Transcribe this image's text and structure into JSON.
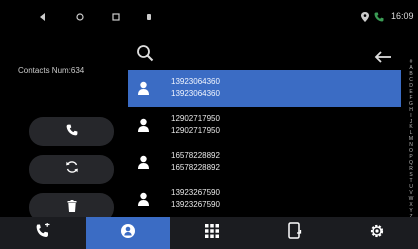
{
  "status_bar": {
    "time": "16:09",
    "icons": [
      "back-triangle-icon",
      "home-circle-icon",
      "recent-square-icon",
      "app-notification-icon",
      "location-icon",
      "phone-icon"
    ]
  },
  "left_panel": {
    "contacts_label": "Contacts Num:634",
    "buttons": [
      {
        "name": "call-button",
        "icon": "phone-icon"
      },
      {
        "name": "sync-button",
        "icon": "refresh-icon"
      },
      {
        "name": "delete-button",
        "icon": "trash-icon"
      }
    ]
  },
  "top_bar": {
    "search_icon": "search-icon",
    "back_icon": "arrow-left-icon"
  },
  "contacts": [
    {
      "line1": "13923064360",
      "line2": "13923064360",
      "selected": true
    },
    {
      "line1": "12902717950",
      "line2": "12902717950",
      "selected": false
    },
    {
      "line1": "16578228892",
      "line2": "16578228892",
      "selected": false
    },
    {
      "line1": "13923267590",
      "line2": "13923267590",
      "selected": false
    }
  ],
  "alphabet": [
    "#",
    "A",
    "B",
    "C",
    "D",
    "E",
    "F",
    "G",
    "H",
    "I",
    "J",
    "K",
    "L",
    "M",
    "N",
    "O",
    "P",
    "Q",
    "R",
    "S",
    "T",
    "U",
    "V",
    "W",
    "X",
    "Y",
    "Z"
  ],
  "bottom_nav": [
    {
      "name": "tab-dial",
      "icon": "call-log-icon",
      "active": false
    },
    {
      "name": "tab-contacts",
      "icon": "contact-icon",
      "active": true
    },
    {
      "name": "tab-keypad",
      "icon": "keypad-icon",
      "active": false
    },
    {
      "name": "tab-device",
      "icon": "phone-device-icon",
      "active": false
    },
    {
      "name": "tab-settings",
      "icon": "gear-icon",
      "active": false
    }
  ],
  "colors": {
    "accent": "#3b6cc4",
    "background": "#000000",
    "button_bg": "#26272b",
    "nav_bg": "#1b1c20"
  }
}
